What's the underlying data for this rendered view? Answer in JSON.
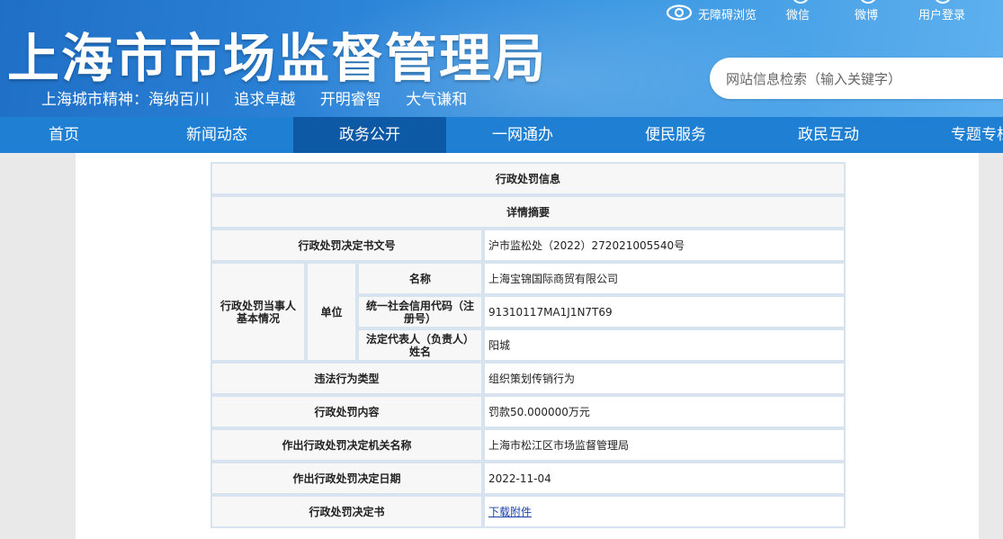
{
  "header": {
    "site_title": "上海市市场监督管理局",
    "spirit": [
      "上海城市精神：海纳百川",
      "追求卓越",
      "开明睿智",
      "大气谦和"
    ],
    "top_links": {
      "accessibility": "无障碍浏览",
      "wechat": "微信",
      "weibo": "微博",
      "login": "用户登录"
    },
    "search_placeholder": "网站信息检索（输入关键字）"
  },
  "nav": {
    "items": [
      "首页",
      "新闻动态",
      "政务公开",
      "一网通办",
      "便民服务",
      "政民互动",
      "专题专栏"
    ],
    "active_index": 2
  },
  "table": {
    "title": "行政处罚信息",
    "subtitle": "详情摘要",
    "decision_no_label": "行政处罚决定书文号",
    "decision_no": "沪市监松处（2022）272021005540号",
    "party_label": "行政处罚当事人基本情况",
    "unit_label": "单位",
    "name_label": "名称",
    "name": "上海宝锦国际商贸有限公司",
    "credit_code_label": "统一社会信用代码（注册号）",
    "credit_code": "91310117MA1J1N7T69",
    "legal_rep_label": "法定代表人（负责人）姓名",
    "legal_rep": "阳城",
    "violation_type_label": "违法行为类型",
    "violation_type": "组织策划传销行为",
    "penalty_content_label": "行政处罚内容",
    "penalty_content": "罚款50.000000万元",
    "authority_label": "作出行政处罚决定机关名称",
    "authority": "上海市松江区市场监督管理局",
    "date_label": "作出行政处罚决定日期",
    "date": "2022-11-04",
    "document_label": "行政处罚决定书",
    "document_link": "下载附件"
  }
}
